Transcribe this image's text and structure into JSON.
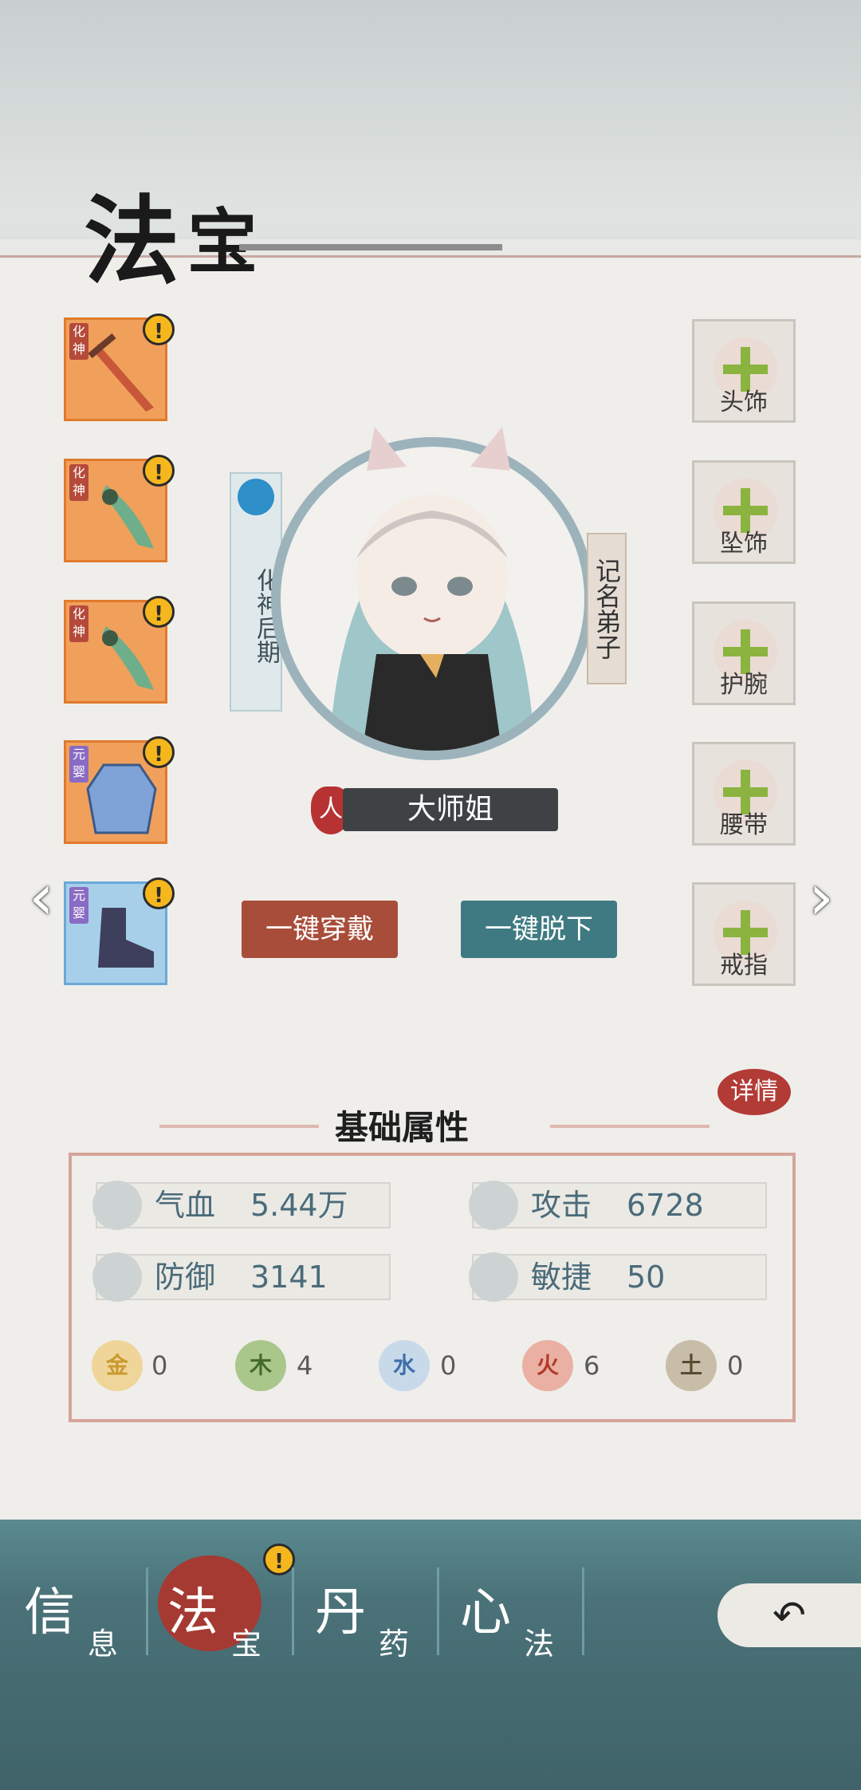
{
  "page": {
    "title_main": "法",
    "title_sub": "宝"
  },
  "left_slots": [
    {
      "tag": "化神",
      "kind": "sword",
      "warn": "!"
    },
    {
      "tag": "化神",
      "kind": "blade",
      "warn": "!"
    },
    {
      "tag": "化神",
      "kind": "blade",
      "warn": "!"
    },
    {
      "tag": "元婴",
      "kind": "robe",
      "warn": "!"
    },
    {
      "tag": "元婴",
      "kind": "boots",
      "warn": "!"
    }
  ],
  "right_slots": [
    "头饰",
    "坠饰",
    "护腕",
    "腰带",
    "戒指"
  ],
  "character": {
    "realm": "化神后期",
    "rank": "记名弟子",
    "name": "大师姐",
    "race_icon": "人"
  },
  "buttons": {
    "equip_all": "一键穿戴",
    "unequip_all": "一键脱下",
    "detail": "详情"
  },
  "attributes": {
    "title": "基础属性",
    "stats": [
      {
        "label": "气血",
        "value": "5.44万",
        "icon": "blood-drop-icon"
      },
      {
        "label": "攻击",
        "value": "6728",
        "icon": "attack-icon"
      },
      {
        "label": "防御",
        "value": "3141",
        "icon": "shield-icon"
      },
      {
        "label": "敏捷",
        "value": "50",
        "icon": "wind-icon"
      }
    ],
    "elements": [
      {
        "glyph": "金",
        "value": "0",
        "color": "#e6b94a"
      },
      {
        "glyph": "木",
        "value": "4",
        "color": "#7fa24a"
      },
      {
        "glyph": "水",
        "value": "0",
        "color": "#8fb3d6"
      },
      {
        "glyph": "火",
        "value": "6",
        "color": "#d9735f"
      },
      {
        "glyph": "土",
        "value": "0",
        "color": "#8e7a5c"
      }
    ]
  },
  "nav": [
    {
      "big": "信",
      "small": "息"
    },
    {
      "big": "法",
      "small": "宝"
    },
    {
      "big": "丹",
      "small": "药"
    },
    {
      "big": "心",
      "small": "法"
    }
  ],
  "nav_warn": "!"
}
